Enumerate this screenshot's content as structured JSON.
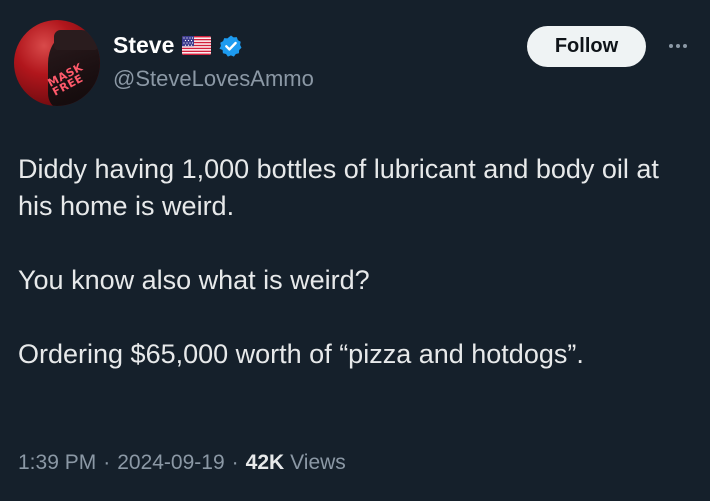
{
  "author": {
    "display_name": "Steve",
    "handle": "@SteveLovesAmmo",
    "flag_icon": "us-flag-icon",
    "verified_icon": "verified-badge-icon",
    "avatar_logo_text": [
      "MASK",
      "FREE"
    ]
  },
  "actions": {
    "follow_label": "Follow",
    "more_icon": "more-options-icon"
  },
  "tweet": {
    "paragraphs": [
      "Diddy having 1,000 bottles of lubricant and body oil at his home is weird.",
      "You know also what is weird?",
      "Ordering $65,000 worth of “pizza and hotdogs”."
    ],
    "time": "1:39 PM",
    "date": "2024-09-19",
    "separator": "·",
    "views_count": "42K",
    "views_label": "Views"
  },
  "colors": {
    "background": "#15202b",
    "text_primary": "#e7e9ea",
    "text_secondary": "#8b98a5",
    "verified_blue": "#1d9bf0",
    "follow_bg": "#eff3f4"
  }
}
